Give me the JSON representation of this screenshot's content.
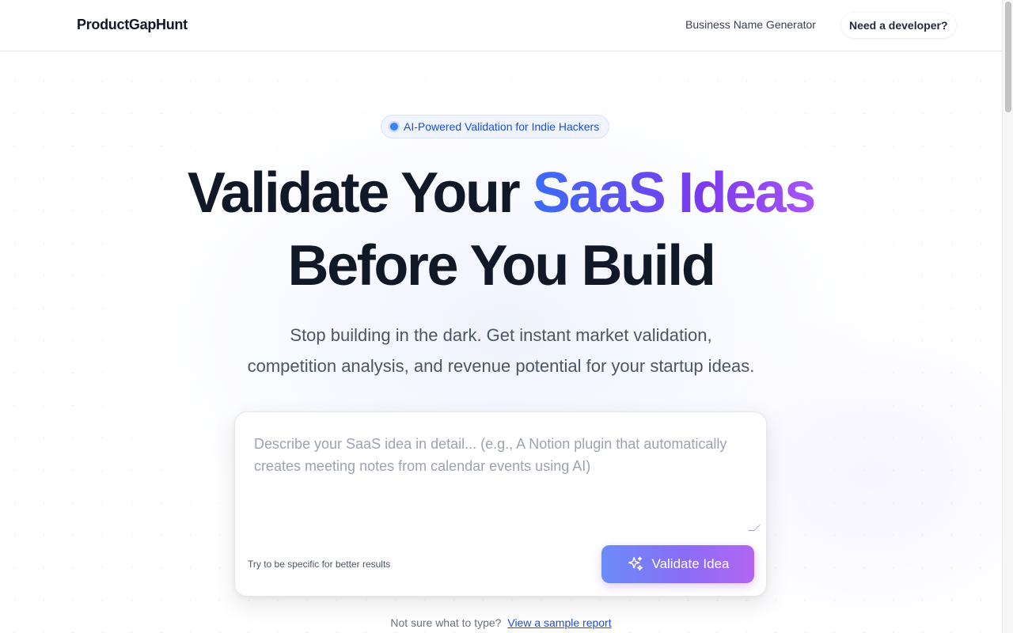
{
  "header": {
    "logo": "ProductGapHunt",
    "nav_business": "Business Name Generator",
    "nav_developer": "Need a developer?"
  },
  "hero": {
    "badge": "AI-Powered Validation for Indie Hackers",
    "headline_part1": "Validate Your ",
    "headline_highlight": "SaaS Ideas",
    "headline_line2": "Before You Build",
    "subtext_line1": "Stop building in the dark. Get instant market validation,",
    "subtext_line2": "competition analysis, and revenue potential for your startup ideas."
  },
  "form": {
    "placeholder": "Describe your SaaS idea in detail... (e.g., A Notion plugin that automatically creates meeting notes from calendar events using AI)",
    "value": "",
    "hint": "Try to be specific for better results",
    "button_label": "Validate Idea",
    "button_icon": "sparkles-icon"
  },
  "footer_prompt": {
    "text": "Not sure what to type?",
    "link": "View a sample report"
  },
  "colors": {
    "accent_blue": "#3b6cf6",
    "accent_purple": "#a855f7",
    "badge_text": "#1d4ed8",
    "heading": "#111827"
  }
}
